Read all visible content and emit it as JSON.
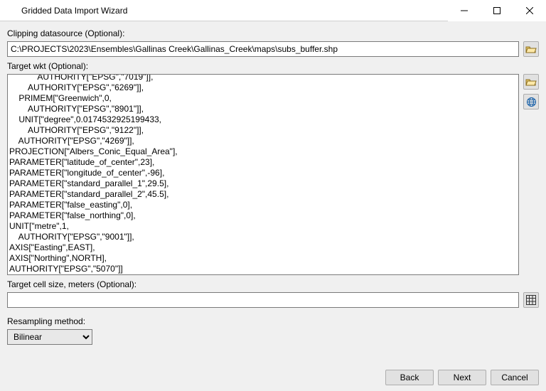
{
  "window": {
    "title": "Gridded Data Import Wizard"
  },
  "clipping": {
    "label": "Clipping datasource (Optional):",
    "value": "C:\\PROJECTS\\2023\\Ensembles\\Gallinas Creek\\Gallinas_Creek\\maps\\subs_buffer.shp"
  },
  "target_wkt": {
    "label": "Target wkt (Optional):",
    "text": "            AUTHORITY[\"EPSG\",\"7019\"]],\n        AUTHORITY[\"EPSG\",\"6269\"]],\n    PRIMEM[\"Greenwich\",0,\n        AUTHORITY[\"EPSG\",\"8901\"]],\n    UNIT[\"degree\",0.0174532925199433,\n        AUTHORITY[\"EPSG\",\"9122\"]],\n    AUTHORITY[\"EPSG\",\"4269\"]],\nPROJECTION[\"Albers_Conic_Equal_Area\"],\nPARAMETER[\"latitude_of_center\",23],\nPARAMETER[\"longitude_of_center\",-96],\nPARAMETER[\"standard_parallel_1\",29.5],\nPARAMETER[\"standard_parallel_2\",45.5],\nPARAMETER[\"false_easting\",0],\nPARAMETER[\"false_northing\",0],\nUNIT[\"metre\",1,\n    AUTHORITY[\"EPSG\",\"9001\"]],\nAXIS[\"Easting\",EAST],\nAXIS[\"Northing\",NORTH],\nAUTHORITY[\"EPSG\",\"5070\"]]"
  },
  "cell_size": {
    "label": "Target cell size, meters (Optional):",
    "value": ""
  },
  "resampling": {
    "label": "Resampling method:",
    "selected": "Bilinear"
  },
  "buttons": {
    "back": "Back",
    "next": "Next",
    "cancel": "Cancel"
  }
}
